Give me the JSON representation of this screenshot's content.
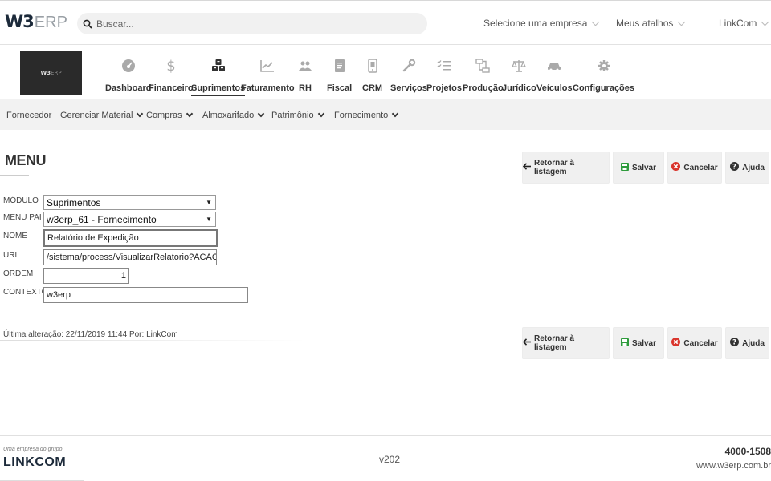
{
  "header": {
    "logo_bold": "W3",
    "logo_light": "ERP",
    "search_placeholder": "Buscar...",
    "company_select": "Selecione uma empresa",
    "shortcuts": "Meus atalhos",
    "user": "LinkCom"
  },
  "modules": {
    "logo_bold": "W3",
    "logo_light": "ERP",
    "items": [
      {
        "label": "Dashboard",
        "icon": "speedometer-icon"
      },
      {
        "label": "Financeiro",
        "icon": "dollar-icon"
      },
      {
        "label": "Suprimentos",
        "icon": "boxes-icon"
      },
      {
        "label": "Faturamento",
        "icon": "chart-icon"
      },
      {
        "label": "RH",
        "icon": "people-icon"
      },
      {
        "label": "Fiscal",
        "icon": "document-icon"
      },
      {
        "label": "CRM",
        "icon": "phone-icon"
      },
      {
        "label": "Serviços",
        "icon": "wrench-icon"
      },
      {
        "label": "Projetos",
        "icon": "list-icon"
      },
      {
        "label": "Produção",
        "icon": "flow-icon"
      },
      {
        "label": "Jurídico",
        "icon": "scale-icon"
      },
      {
        "label": "Veículos",
        "icon": "car-icon"
      },
      {
        "label": "Configurações",
        "icon": "gear-icon"
      }
    ],
    "active": "Suprimentos"
  },
  "subnav": {
    "items": [
      {
        "label": "Fornecedor",
        "dropdown": false
      },
      {
        "label": "Gerenciar Material",
        "dropdown": true
      },
      {
        "label": "Compras",
        "dropdown": true
      },
      {
        "label": "Almoxarifado",
        "dropdown": true
      },
      {
        "label": "Patrimônio",
        "dropdown": true
      },
      {
        "label": "Fornecimento",
        "dropdown": true
      }
    ]
  },
  "page": {
    "title": "MENU",
    "buttons": {
      "back": "Retornar à listagem",
      "save": "Salvar",
      "cancel": "Cancelar",
      "help": "Ajuda"
    },
    "colors": {
      "save": "#2e9b3c",
      "cancel": "#d9342b",
      "help": "#333333"
    }
  },
  "form": {
    "modulo": {
      "label": "MÓDULO",
      "value": "Suprimentos"
    },
    "menu_pai": {
      "label": "MENU PAI",
      "value": "w3erp_61 - Fornecimento"
    },
    "nome": {
      "label": "NOME",
      "value": "Relatório de Expedição"
    },
    "url": {
      "label": "URL",
      "value": "/sistema/process/VisualizarRelatorio?ACAO=index"
    },
    "ordem": {
      "label": "ORDEM",
      "value": "1"
    },
    "contexto": {
      "label": "CONTEXTO",
      "value": "w3erp"
    }
  },
  "last_change": "Última alteração: 22/11/2019 11:44 Por: LinkCom",
  "footer": {
    "tagline": "Uma empresa do grupo",
    "brand": "LINKCOM",
    "version": "v202",
    "phone": "4000-1508",
    "site": "www.w3erp.com.br"
  }
}
